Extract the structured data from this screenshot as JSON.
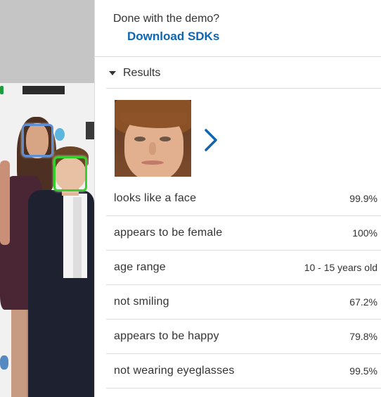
{
  "panel": {
    "demo_question": "Done with the demo?",
    "sdk_link": "Download SDKs",
    "results_label": "Results"
  },
  "results": [
    {
      "label": "looks like a face",
      "value": "99.9%"
    },
    {
      "label": "appears to be female",
      "value": "100%"
    },
    {
      "label": "age range",
      "value": "10 - 15 years old"
    },
    {
      "label": "not smiling",
      "value": "67.2%"
    },
    {
      "label": "appears to be happy",
      "value": "79.8%"
    },
    {
      "label": "not wearing eyeglasses",
      "value": "99.5%"
    }
  ],
  "colors": {
    "link": "#0f65b1",
    "face_box_selected": "#36d02b",
    "face_box_other": "#5d8fd6"
  },
  "icons": {
    "results_toggle": "caret-down-icon",
    "next_face": "chevron-right-icon"
  }
}
